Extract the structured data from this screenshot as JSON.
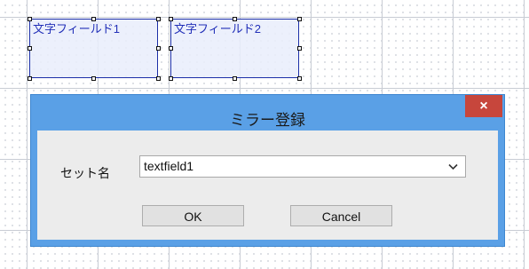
{
  "canvas": {
    "fields": [
      {
        "label": "文字フィールド1"
      },
      {
        "label": "文字フィールド2"
      }
    ]
  },
  "dialog": {
    "title": "ミラー登録",
    "close_icon": "close-icon",
    "close_glyph": "×",
    "set_name_label": "セット名",
    "set_name_value": "textfield1",
    "dropdown_icon": "chevron-down-icon",
    "ok_label": "OK",
    "cancel_label": "Cancel"
  },
  "colors": {
    "title_bar": "#5aa0e6",
    "close_button": "#c7463c",
    "field_border": "#1c2fa8",
    "field_text": "#2230b8"
  }
}
